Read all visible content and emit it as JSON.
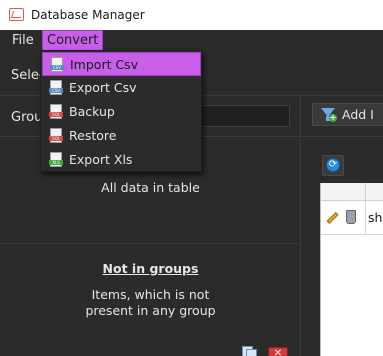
{
  "window": {
    "title": "Database Manager"
  },
  "menubar": {
    "file": "File",
    "convert": "Convert"
  },
  "toolbar": {
    "select_label": "Selec"
  },
  "left_panel": {
    "group_label": "Group",
    "all_data_text": "All data in table",
    "not_in_groups_title": "Not in groups",
    "not_in_groups_desc_line1": "Items, which is not",
    "not_in_groups_desc_line2": "present in any group"
  },
  "right_panel": {
    "add_button_label": "Add I",
    "table": {
      "rows": [
        {
          "cell": "sha"
        }
      ]
    }
  },
  "convert_menu": {
    "items": [
      {
        "label": "Import Csv",
        "icon_tag": "CSV",
        "active": true
      },
      {
        "label": "Export Csv",
        "icon_tag": "CSV",
        "active": false
      },
      {
        "label": "Backup",
        "icon_tag": "SQL",
        "active": false
      },
      {
        "label": "Restore",
        "icon_tag": "SQL",
        "active": false
      },
      {
        "label": "Export Xls",
        "icon_tag": "XLS",
        "active": false
      }
    ]
  },
  "colors": {
    "accent": "#c85fe8",
    "background": "#2b2b2b",
    "csv_tag": "#5a8cc4",
    "sql_tag": "#d04a4a",
    "xls_tag": "#3fa83f"
  }
}
